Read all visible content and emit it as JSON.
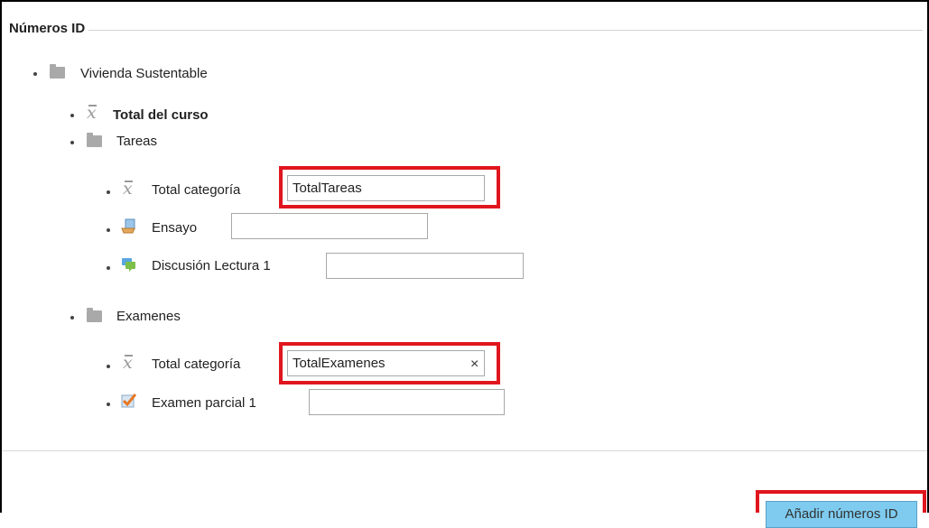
{
  "section": {
    "title": "Números ID"
  },
  "tree": {
    "root": {
      "label": "Vivienda Sustentable",
      "icon": "folder-icon"
    },
    "course_total": {
      "label": "Total del curso",
      "icon": "xbar-icon"
    },
    "tareas": {
      "label": "Tareas",
      "icon": "folder-icon",
      "total": {
        "label": "Total categoría",
        "value": "TotalTareas"
      },
      "ensayo": {
        "label": "Ensayo",
        "icon": "assignment-icon",
        "value": ""
      },
      "discusion": {
        "label": "Discusión Lectura 1",
        "icon": "forum-icon",
        "value": ""
      }
    },
    "examenes": {
      "label": "Examenes",
      "icon": "folder-icon",
      "total": {
        "label": "Total categoría",
        "value": "TotalExamenes",
        "clear_glyph": "×"
      },
      "parcial": {
        "label": "Examen parcial 1",
        "icon": "quiz-check-icon",
        "value": ""
      }
    }
  },
  "actions": {
    "submit_label": "Añadir números ID"
  },
  "colors": {
    "highlight": "#e0161e",
    "button_bg": "#7ecbef",
    "folder": "#a9a9a9"
  }
}
